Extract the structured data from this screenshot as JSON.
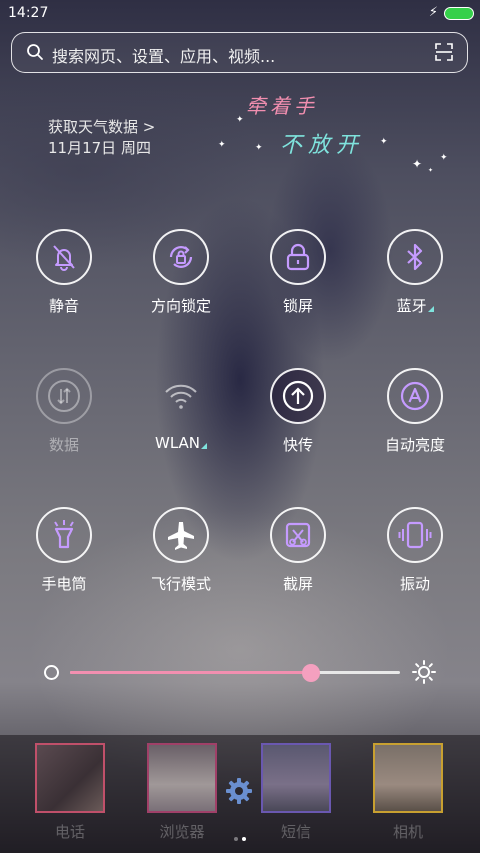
{
  "status_bar": {
    "time": "14:27",
    "charging_icon": "bolt-icon",
    "battery_color": "#35d04a"
  },
  "search": {
    "placeholder": "搜索网页、设置、应用、视频..."
  },
  "weather": {
    "link": "获取天气数据 >",
    "date": "11月17日 周四"
  },
  "wallpaper_text": {
    "line1": "牵着手",
    "line2": "不放开"
  },
  "toggles": [
    {
      "label": "静音",
      "icon": "bell-off-icon",
      "state": "on"
    },
    {
      "label": "方向锁定",
      "icon": "rotation-lock-icon",
      "state": "on"
    },
    {
      "label": "锁屏",
      "icon": "lock-icon",
      "state": "on"
    },
    {
      "label": "蓝牙",
      "icon": "bluetooth-icon",
      "state": "on"
    },
    {
      "label": "数据",
      "icon": "mobile-data-icon",
      "state": "disabled"
    },
    {
      "label": "WLAN",
      "icon": "wifi-icon",
      "state": "off"
    },
    {
      "label": "快传",
      "icon": "quick-transfer-icon",
      "state": "active"
    },
    {
      "label": "自动亮度",
      "icon": "auto-brightness-icon",
      "state": "on"
    },
    {
      "label": "手电筒",
      "icon": "flashlight-icon",
      "state": "on"
    },
    {
      "label": "飞行模式",
      "icon": "airplane-icon",
      "state": "on"
    },
    {
      "label": "截屏",
      "icon": "screenshot-icon",
      "state": "on"
    },
    {
      "label": "振动",
      "icon": "vibrate-icon",
      "state": "on"
    }
  ],
  "brightness": {
    "level": 0.73,
    "accent": "#f28fb0"
  },
  "dock": [
    {
      "label": "电话",
      "border": "#c0506a"
    },
    {
      "label": "浏览器",
      "border": "#a04068"
    },
    {
      "label": "短信",
      "border": "#6a58b0"
    },
    {
      "label": "相机",
      "border": "#c8a030"
    }
  ],
  "page_indicator": {
    "count": 2,
    "current": 2
  }
}
